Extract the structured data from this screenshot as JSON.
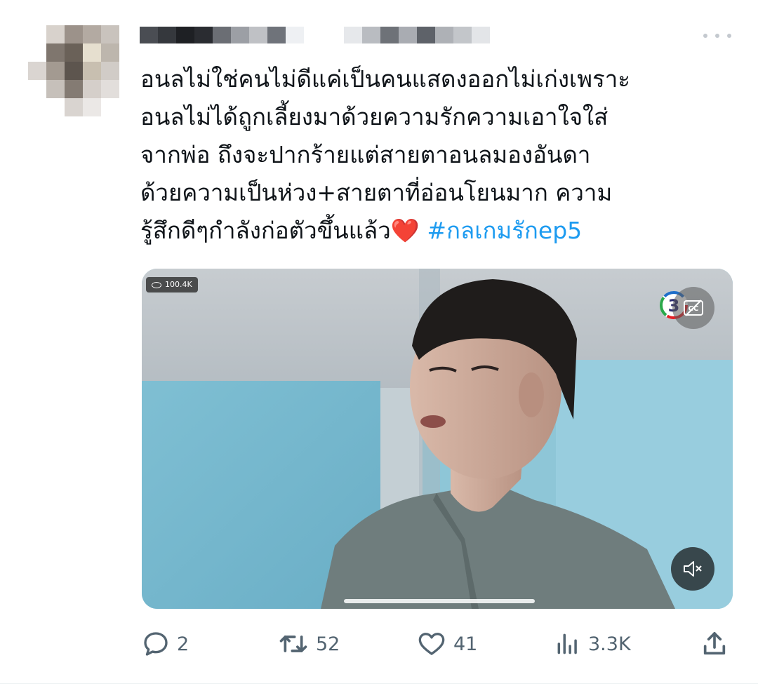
{
  "tweet": {
    "text_lines": [
      "อนลไม่ใช่คนไม่ดีแค่เป็นคนแสดงออกไม่เก่งเพราะ",
      "อนลไม่ได้ถูกเลี้ยงมาด้วยความรักความเอาใจใส่",
      "จากพ่อ ถึงจะปากร้ายแต่สายตาอนลมองอันดา",
      "ด้วยความเป็นห่วง+สายตาที่อ่อนโยนมาก ความ",
      "รู้สึกดีๆกำลังก่อตัวขึ้นแล้ว"
    ],
    "emoji": "❤️",
    "hashtag": "#กลเกมรักep5"
  },
  "video": {
    "views": "100.4K",
    "channel_logo": "channel-3-logo",
    "cc_icon": "closed-captions-icon",
    "mute_icon": "volume-muted-icon"
  },
  "actions": {
    "replies": "2",
    "retweets": "52",
    "likes": "41",
    "views": "3.3K"
  },
  "colors": {
    "text": "#0f1419",
    "hashtag": "#1d9bf0",
    "icon_gray": "#536471",
    "heart": "#e0243a"
  }
}
